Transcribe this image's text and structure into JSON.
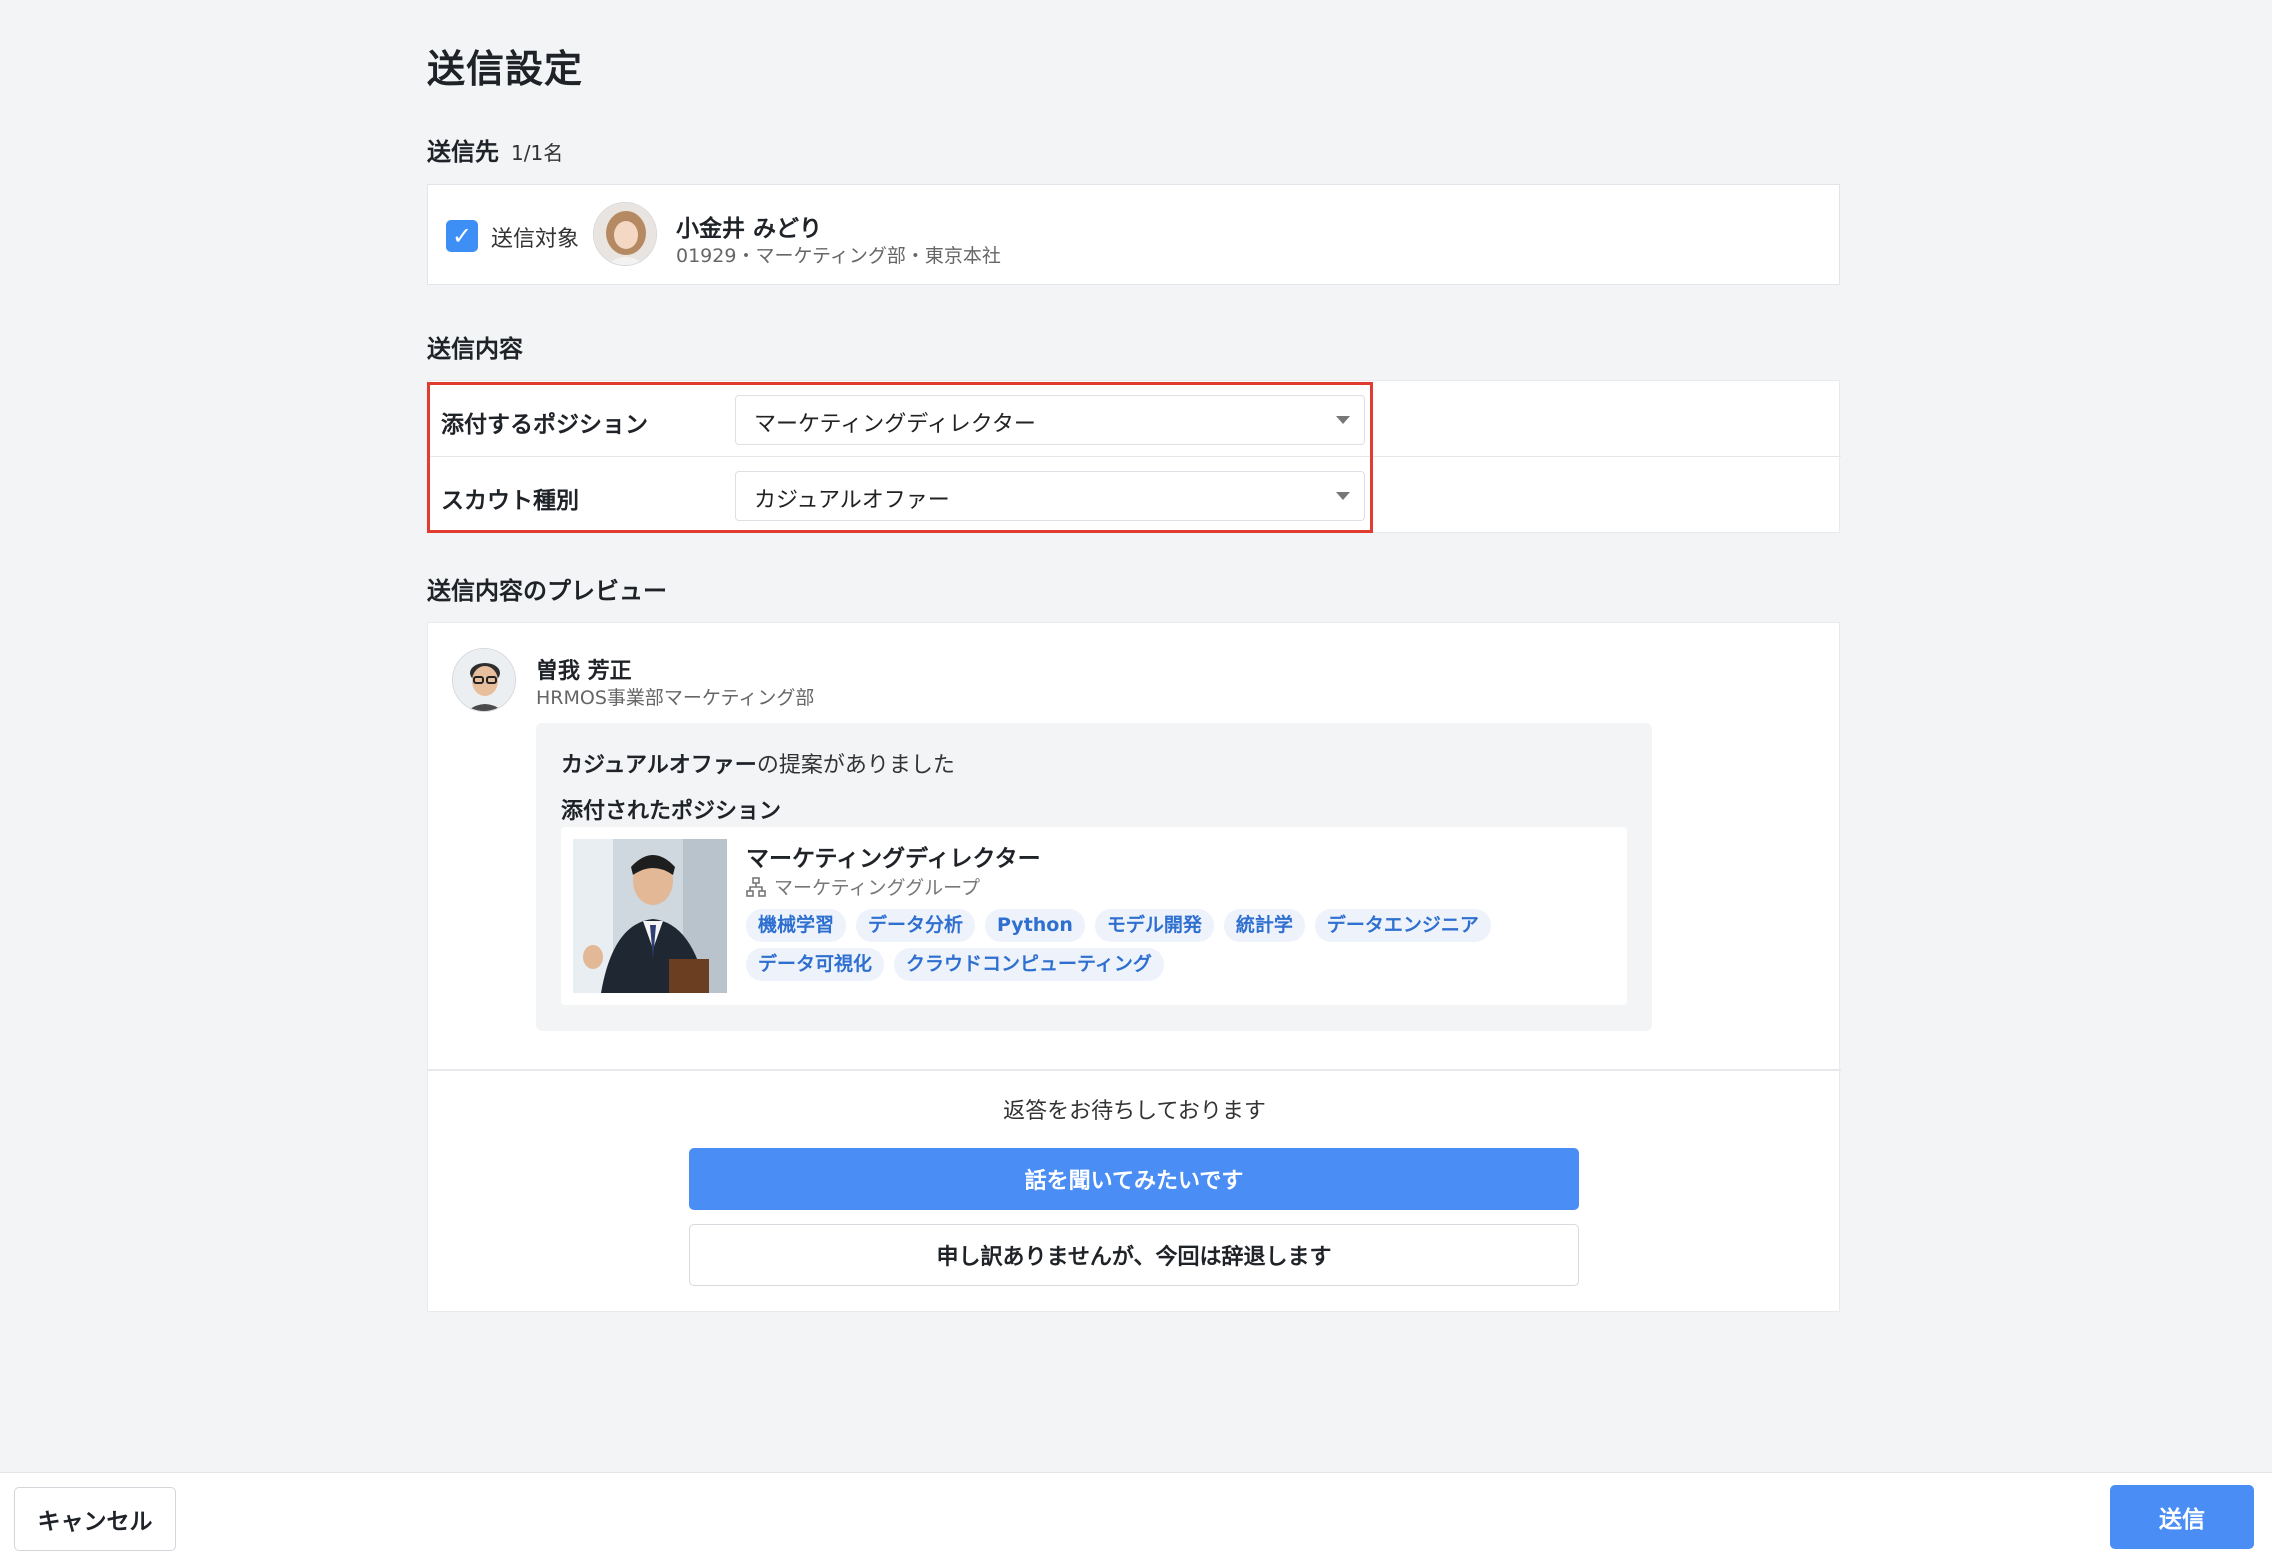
{
  "page": {
    "title": "送信設定"
  },
  "recipients": {
    "section_title": "送信先",
    "count": "1/1名",
    "checkbox_label": "送信対象",
    "name": "小金井 みどり",
    "meta": "01929・マーケティング部・東京本社"
  },
  "content": {
    "section_title": "送信内容",
    "position_label": "添付するポジション",
    "position_value": "マーケティングディレクター",
    "scout_type_label": "スカウト種別",
    "scout_type_value": "カジュアルオファー"
  },
  "preview": {
    "section_title": "送信内容のプレビュー",
    "sender_name": "曽我 芳正",
    "sender_dept": "HRMOS事業部マーケティング部",
    "offer_type": "カジュアルオファー",
    "offer_suffix": "の提案がありました",
    "attached_title": "添付されたポジション",
    "position_title": "マーケティングディレクター",
    "position_group": "マーケティンググループ",
    "tags": [
      "機械学習",
      "データ分析",
      "Python",
      "モデル開発",
      "統計学",
      "データエンジニア",
      "データ可視化",
      "クラウドコンピューティング"
    ],
    "reply_wait": "返答をお待ちしております",
    "accept_button": "話を聞いてみたいです",
    "decline_button": "申し訳ありませんが、今回は辞退します"
  },
  "footer": {
    "cancel": "キャンセル",
    "send": "送信"
  },
  "colors": {
    "accent": "#4a8ef5",
    "highlight": "#e03c2f",
    "tag_bg": "#eef3fb",
    "tag_text": "#2e6fd0"
  }
}
